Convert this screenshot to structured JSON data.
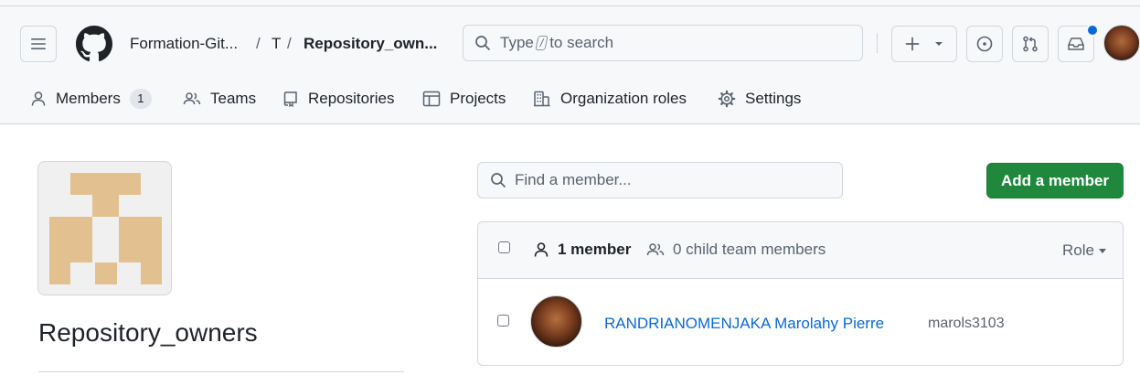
{
  "header": {
    "breadcrumb": {
      "org": "Formation-Git...",
      "separator": "/",
      "team_parent": "T",
      "team": "Repository_own..."
    },
    "search": {
      "prefix": "Type",
      "key": "/",
      "suffix": "to search"
    },
    "notification_indicator_color": "#0969da"
  },
  "tabs": [
    {
      "label": "Members",
      "icon": "person-icon",
      "count": "1"
    },
    {
      "label": "Teams",
      "icon": "people-icon"
    },
    {
      "label": "Repositories",
      "icon": "repo-icon"
    },
    {
      "label": "Projects",
      "icon": "table-icon"
    },
    {
      "label": "Organization roles",
      "icon": "organization-icon"
    },
    {
      "label": "Settings",
      "icon": "gear-icon"
    }
  ],
  "team": {
    "name": "Repository_owners",
    "avatar_color": "#e3c08f"
  },
  "members_panel": {
    "find_placeholder": "Find a member...",
    "add_button": "Add a member",
    "header": {
      "member_count": "1 member",
      "child_team_members": "0 child team members",
      "role_filter": "Role"
    },
    "members": [
      {
        "name": "RANDRIANOMENJAKA Marolahy Pierre",
        "login": "marols3103"
      }
    ]
  },
  "colors": {
    "accent": "#1f883d",
    "link": "#0969da",
    "header_bg": "#f6f8fa",
    "border": "#d0d7de"
  }
}
